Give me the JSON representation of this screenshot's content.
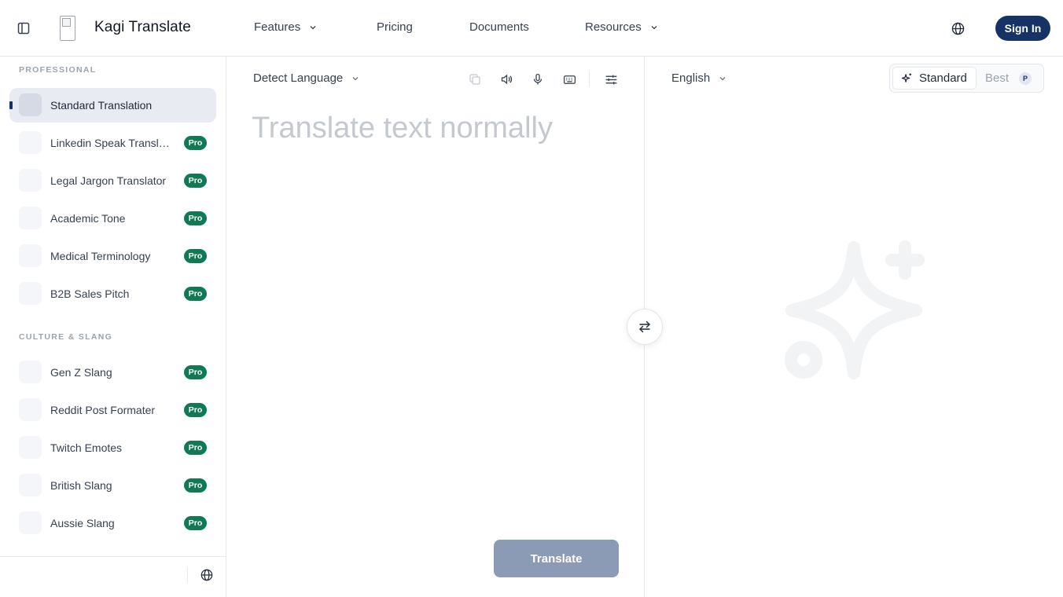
{
  "header": {
    "brand": "Kagi Translate",
    "nav": {
      "features": "Features",
      "pricing": "Pricing",
      "documents": "Documents",
      "resources": "Resources"
    },
    "signin_label": "Sign In"
  },
  "sidebar": {
    "professional_title": "PROFESSIONAL",
    "culture_title": "CULTURE & SLANG",
    "professional_items": [
      {
        "label": "Standard Translation"
      },
      {
        "label": "Linkedin Speak Translator",
        "badge": "Pro"
      },
      {
        "label": "Legal Jargon Translator",
        "badge": "Pro"
      },
      {
        "label": "Academic Tone",
        "badge": "Pro"
      },
      {
        "label": "Medical Terminology",
        "badge": "Pro"
      },
      {
        "label": "B2B Sales Pitch",
        "badge": "Pro"
      }
    ],
    "culture_items": [
      {
        "label": "Gen Z Slang",
        "badge": "Pro"
      },
      {
        "label": "Reddit Post Formater",
        "badge": "Pro"
      },
      {
        "label": "Twitch Emotes",
        "badge": "Pro"
      },
      {
        "label": "British Slang",
        "badge": "Pro"
      },
      {
        "label": "Aussie Slang",
        "badge": "Pro"
      }
    ]
  },
  "source": {
    "language": "Detect Language",
    "placeholder": "Translate text normally",
    "value": "",
    "translate_label": "Translate"
  },
  "target": {
    "language": "English",
    "mode_standard": "Standard",
    "mode_best": "Best",
    "mode_best_badge": "P"
  },
  "colors": {
    "accent": "#163366",
    "pro_badge": "#0f7a53",
    "translate_disabled": "#8c9bb5"
  }
}
